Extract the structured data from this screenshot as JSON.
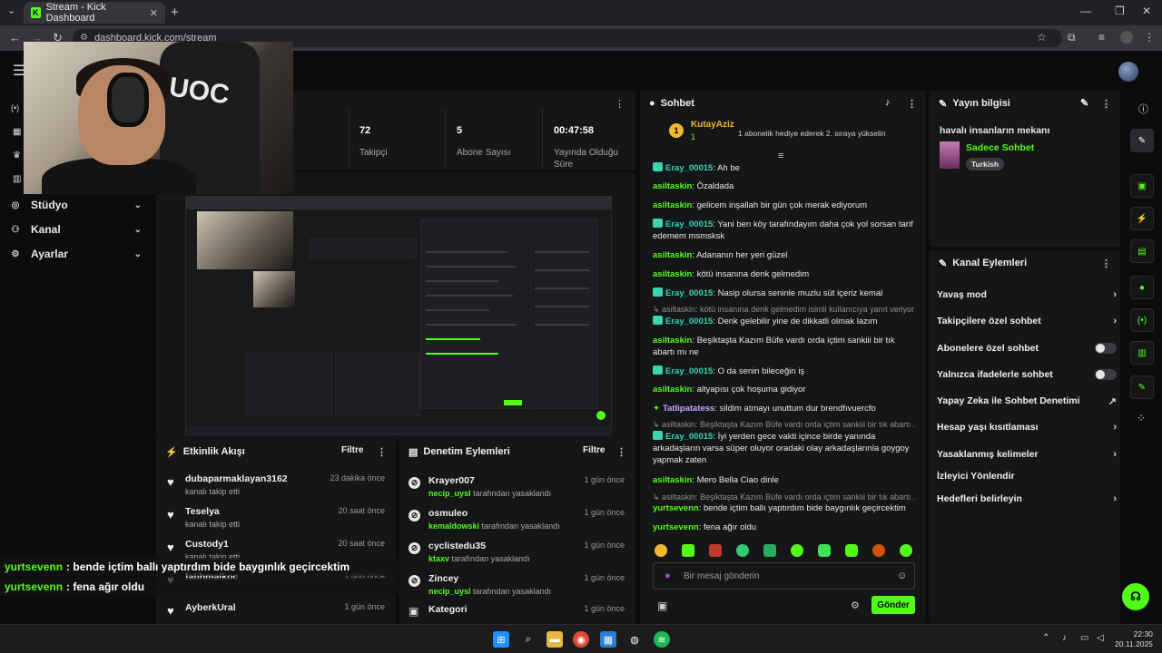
{
  "browser": {
    "tab_title": "Stream - Kick Dashboard",
    "tab_favicon": "K",
    "url": "dashboard.kick.com/stream"
  },
  "sidebar": {
    "items": [
      {
        "label": "Stüdyo",
        "icon": "studio-icon"
      },
      {
        "label": "Kanal",
        "icon": "channel-icon"
      },
      {
        "label": "Ayarlar",
        "icon": "settings-icon"
      }
    ]
  },
  "stats": [
    {
      "value": "72",
      "label": "Takipçi"
    },
    {
      "value": "5",
      "label": "Abone Sayısı"
    },
    {
      "value": "00:47:58",
      "label": "Yayında Olduğu Süre"
    }
  ],
  "activity": {
    "title": "Etkinlik Akışı",
    "filter": "Filtre",
    "items": [
      {
        "name": "dubaparmaklayan3162",
        "sub": "kanalı takip etti",
        "time": "23 dakika önce"
      },
      {
        "name": "Teselya",
        "sub": "kanalı takip etti",
        "time": "20 saat önce"
      },
      {
        "name": "Custody1",
        "sub": "kanalı takip etti",
        "time": "20 saat önce"
      },
      {
        "name": "fatihmalkoc",
        "sub": "",
        "time": "1 gün önce"
      },
      {
        "name": "AyberkUral",
        "sub": "",
        "time": "1 gün önce"
      }
    ]
  },
  "overlay_chat": [
    {
      "user": "yurtsevenn",
      "text": ": bende içtim ballı yaptırdım bide baygınlık geçircektim"
    },
    {
      "user": "yurtsevenn",
      "text": ": fena ağır oldu"
    }
  ],
  "moderation": {
    "title": "Denetim Eylemleri",
    "filter": "Filtre",
    "items": [
      {
        "name": "Krayer007",
        "by": "necip_uysl",
        "action": "tarafından yasaklandı",
        "time": "1 gün önce"
      },
      {
        "name": "osmuleo",
        "by": "kemaldowski",
        "action": "tarafından yasaklandı",
        "time": "1 gün önce"
      },
      {
        "name": "cyclistedu35",
        "by": "ktaxv",
        "action": "tarafından yasaklandı",
        "time": "1 gün önce"
      },
      {
        "name": "Zincey",
        "by": "necip_uysl",
        "action": "tarafından yasaklandı",
        "time": "1 gün önce"
      },
      {
        "name": "Kategori",
        "by": "",
        "action": "",
        "time": "1 gün önce"
      }
    ]
  },
  "chat": {
    "title": "Sohbet",
    "pinned_user": "KutayAziz",
    "pinned_count": "1",
    "pinned_text": "1 abonelik hediye ederek 2. sıraya yükselin",
    "messages": [
      {
        "user": "Eray_00015",
        "text": ": Ah be",
        "badge": true
      },
      {
        "user": "asiltaskin",
        "text": ": Özaldada",
        "badge": false
      },
      {
        "user": "asiltaskin",
        "text": ": gelicem inşallah bir gün çok merak ediyorum",
        "badge": false
      },
      {
        "user": "Eray_00015",
        "text": ": Yani ben köy tarafındayım daha çok yol sorsan tarif edemem msmsksk",
        "badge": true
      },
      {
        "user": "asiltaskin",
        "text": ": Adananın her yeri güzel",
        "badge": false
      },
      {
        "user": "asiltaskin",
        "text": ": kötü insanına denk gelmedim",
        "badge": false
      },
      {
        "user": "Eray_00015",
        "text": ": Nasip olursa seninle muzlu süt içeriz kemal",
        "badge": true
      },
      {
        "user": "Eray_00015",
        "text": ": Denk gelebilir yine de dikkatli olmak lazım",
        "badge": true
      },
      {
        "user": "asiltaskin",
        "text": ": Beşiktaşta Kazım Büfe vardı orda içtim sankiii bir tık abartı mı ne",
        "badge": false
      },
      {
        "user": "Eray_00015",
        "text": ": O da senin bileceğin iş",
        "badge": true
      },
      {
        "user": "asiltaskin",
        "text": ": altyapısı çok hoşuma gidiyor",
        "badge": false
      },
      {
        "user": "Tatlipatatess",
        "text": ": sildim atmayı unuttum dur brendfıvuercfo",
        "badge": false
      },
      {
        "user": "Eray_00015",
        "text": ": İyi yerden gece vakti içince birde yanında arkadaşların varsa süper oluyor oradaki olay arkadaşlarınla goygoy yapmak zaten",
        "badge": true
      },
      {
        "user": "asiltaskin",
        "text": ": Mero Bella Ciao dinle",
        "badge": false
      },
      {
        "user": "yurtsevenn",
        "text": ": bende içtim ballı yaptırdım bide baygınlık geçircektim",
        "badge": false
      },
      {
        "user": "yurtsevenn",
        "text": ": fena ağır oldu",
        "badge": false
      }
    ],
    "replies": [
      "asiltaskin: kötü insanına denk gelmedim isimli kullanıcıya yanıt veriyor",
      "asiltaskin: Beşiktaşta Kazım Büfe vardı orda içtim sankiii bir tık abartı ...",
      "asiltaskin: Beşiktaşta Kazım Büfe vardı orda içtim sankiii bir tık abartı ..."
    ],
    "input_placeholder": "Bir mesaj gönderin",
    "send_label": "Gönder"
  },
  "stream_info": {
    "title": "Yayın bilgisi",
    "stream_title": "havalı insanların mekanı",
    "category": "Sadece Sohbet",
    "tag": "Turkish"
  },
  "channel_actions": {
    "title": "Kanal Eylemleri",
    "items": [
      {
        "label": "Yavaş mod",
        "control": "chevron"
      },
      {
        "label": "Takipçilere özel sohbet",
        "control": "chevron"
      },
      {
        "label": "Abonelere özel sohbet",
        "control": "toggle"
      },
      {
        "label": "Yalnızca ifadelerle sohbet",
        "control": "toggle"
      },
      {
        "label": "Yapay Zeka ile Sohbet Denetimi",
        "control": "external"
      },
      {
        "label": "Hesap yaşı kısıtlaması",
        "control": "chevron"
      },
      {
        "label": "Yasaklanmış kelimeler",
        "control": "chevron"
      },
      {
        "label": "İzleyici Yönlendir",
        "control": "none"
      },
      {
        "label": "Hedefleri belirleyin",
        "control": "chevron"
      }
    ]
  },
  "taskbar": {
    "time": "22:30",
    "date": "20.11.2025"
  },
  "colors": {
    "accent": "#53fc18",
    "badge": "#3bd4b0",
    "panel": "#151618",
    "bg": "#0b0c0d"
  }
}
